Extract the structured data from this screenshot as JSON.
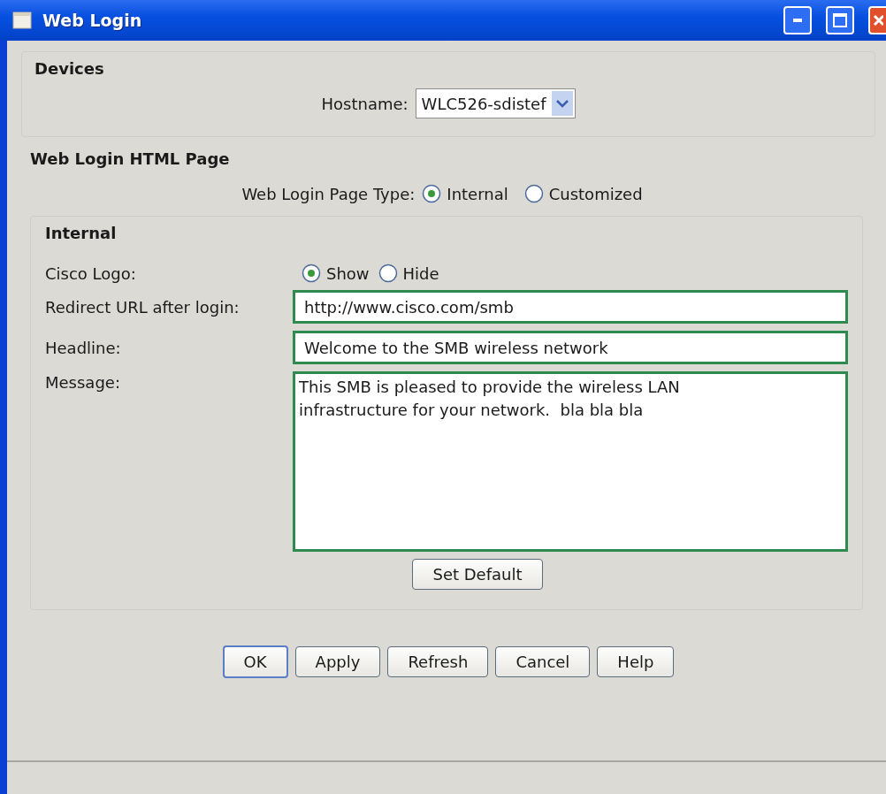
{
  "window": {
    "title": "Web Login"
  },
  "devices": {
    "title": "Devices",
    "hostname_label": "Hostname:",
    "hostname_value": "WLC526-sdistef"
  },
  "html_page": {
    "title": "Web Login HTML Page",
    "page_type_label": "Web Login Page Type:",
    "page_type_options": [
      {
        "label": "Internal",
        "selected": true
      },
      {
        "label": "Customized",
        "selected": false
      }
    ]
  },
  "internal": {
    "title": "Internal",
    "logo_label": "Cisco Logo:",
    "logo_options": [
      {
        "label": "Show",
        "selected": true
      },
      {
        "label": "Hide",
        "selected": false
      }
    ],
    "redirect_label": "Redirect URL after login:",
    "redirect_value": "http://www.cisco.com/smb",
    "headline_label": "Headline:",
    "headline_value": "Welcome to the SMB wireless network",
    "message_label": "Message:",
    "message_value": "This SMB is pleased to provide the wireless LAN infrastructure for your network.  bla bla bla",
    "set_default": "Set Default"
  },
  "buttons": [
    {
      "label": "OK",
      "default": true
    },
    {
      "label": "Apply",
      "default": false
    },
    {
      "label": "Refresh",
      "default": false
    },
    {
      "label": "Cancel",
      "default": false
    },
    {
      "label": "Help",
      "default": false
    }
  ]
}
